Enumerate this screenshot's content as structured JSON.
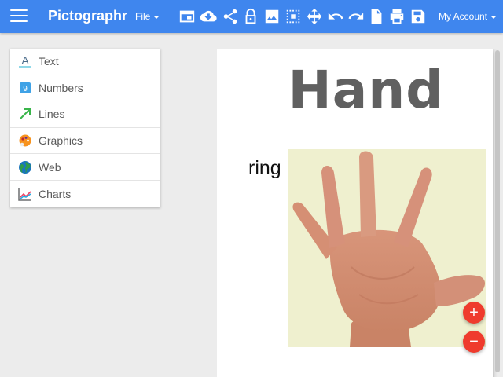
{
  "app": {
    "brand": "Pictographr",
    "file_menu": "File",
    "account_menu": "My Account",
    "accent_color": "#3f86ee"
  },
  "toolbar": {
    "tools": [
      {
        "name": "window-icon"
      },
      {
        "name": "cloud-download-icon"
      },
      {
        "name": "share-icon"
      },
      {
        "name": "lock-icon"
      },
      {
        "name": "image-icon"
      },
      {
        "name": "select-grid-icon"
      },
      {
        "name": "move-icon"
      },
      {
        "name": "undo-icon"
      },
      {
        "name": "redo-icon"
      },
      {
        "name": "document-icon"
      },
      {
        "name": "print-icon"
      },
      {
        "name": "save-icon"
      }
    ]
  },
  "sidebar": {
    "items": [
      {
        "label": "Text",
        "icon": "text-icon"
      },
      {
        "label": "Numbers",
        "icon": "numbers-icon"
      },
      {
        "label": "Lines",
        "icon": "lines-icon"
      },
      {
        "label": "Graphics",
        "icon": "graphics-icon"
      },
      {
        "label": "Web",
        "icon": "globe-icon"
      },
      {
        "label": "Charts",
        "icon": "chart-icon"
      }
    ]
  },
  "canvas": {
    "title": "Hand",
    "word": "ring",
    "image_icon": "hand-photo",
    "zoom_in": "+",
    "zoom_out": "−",
    "fab_color": "#ef3b2d"
  }
}
